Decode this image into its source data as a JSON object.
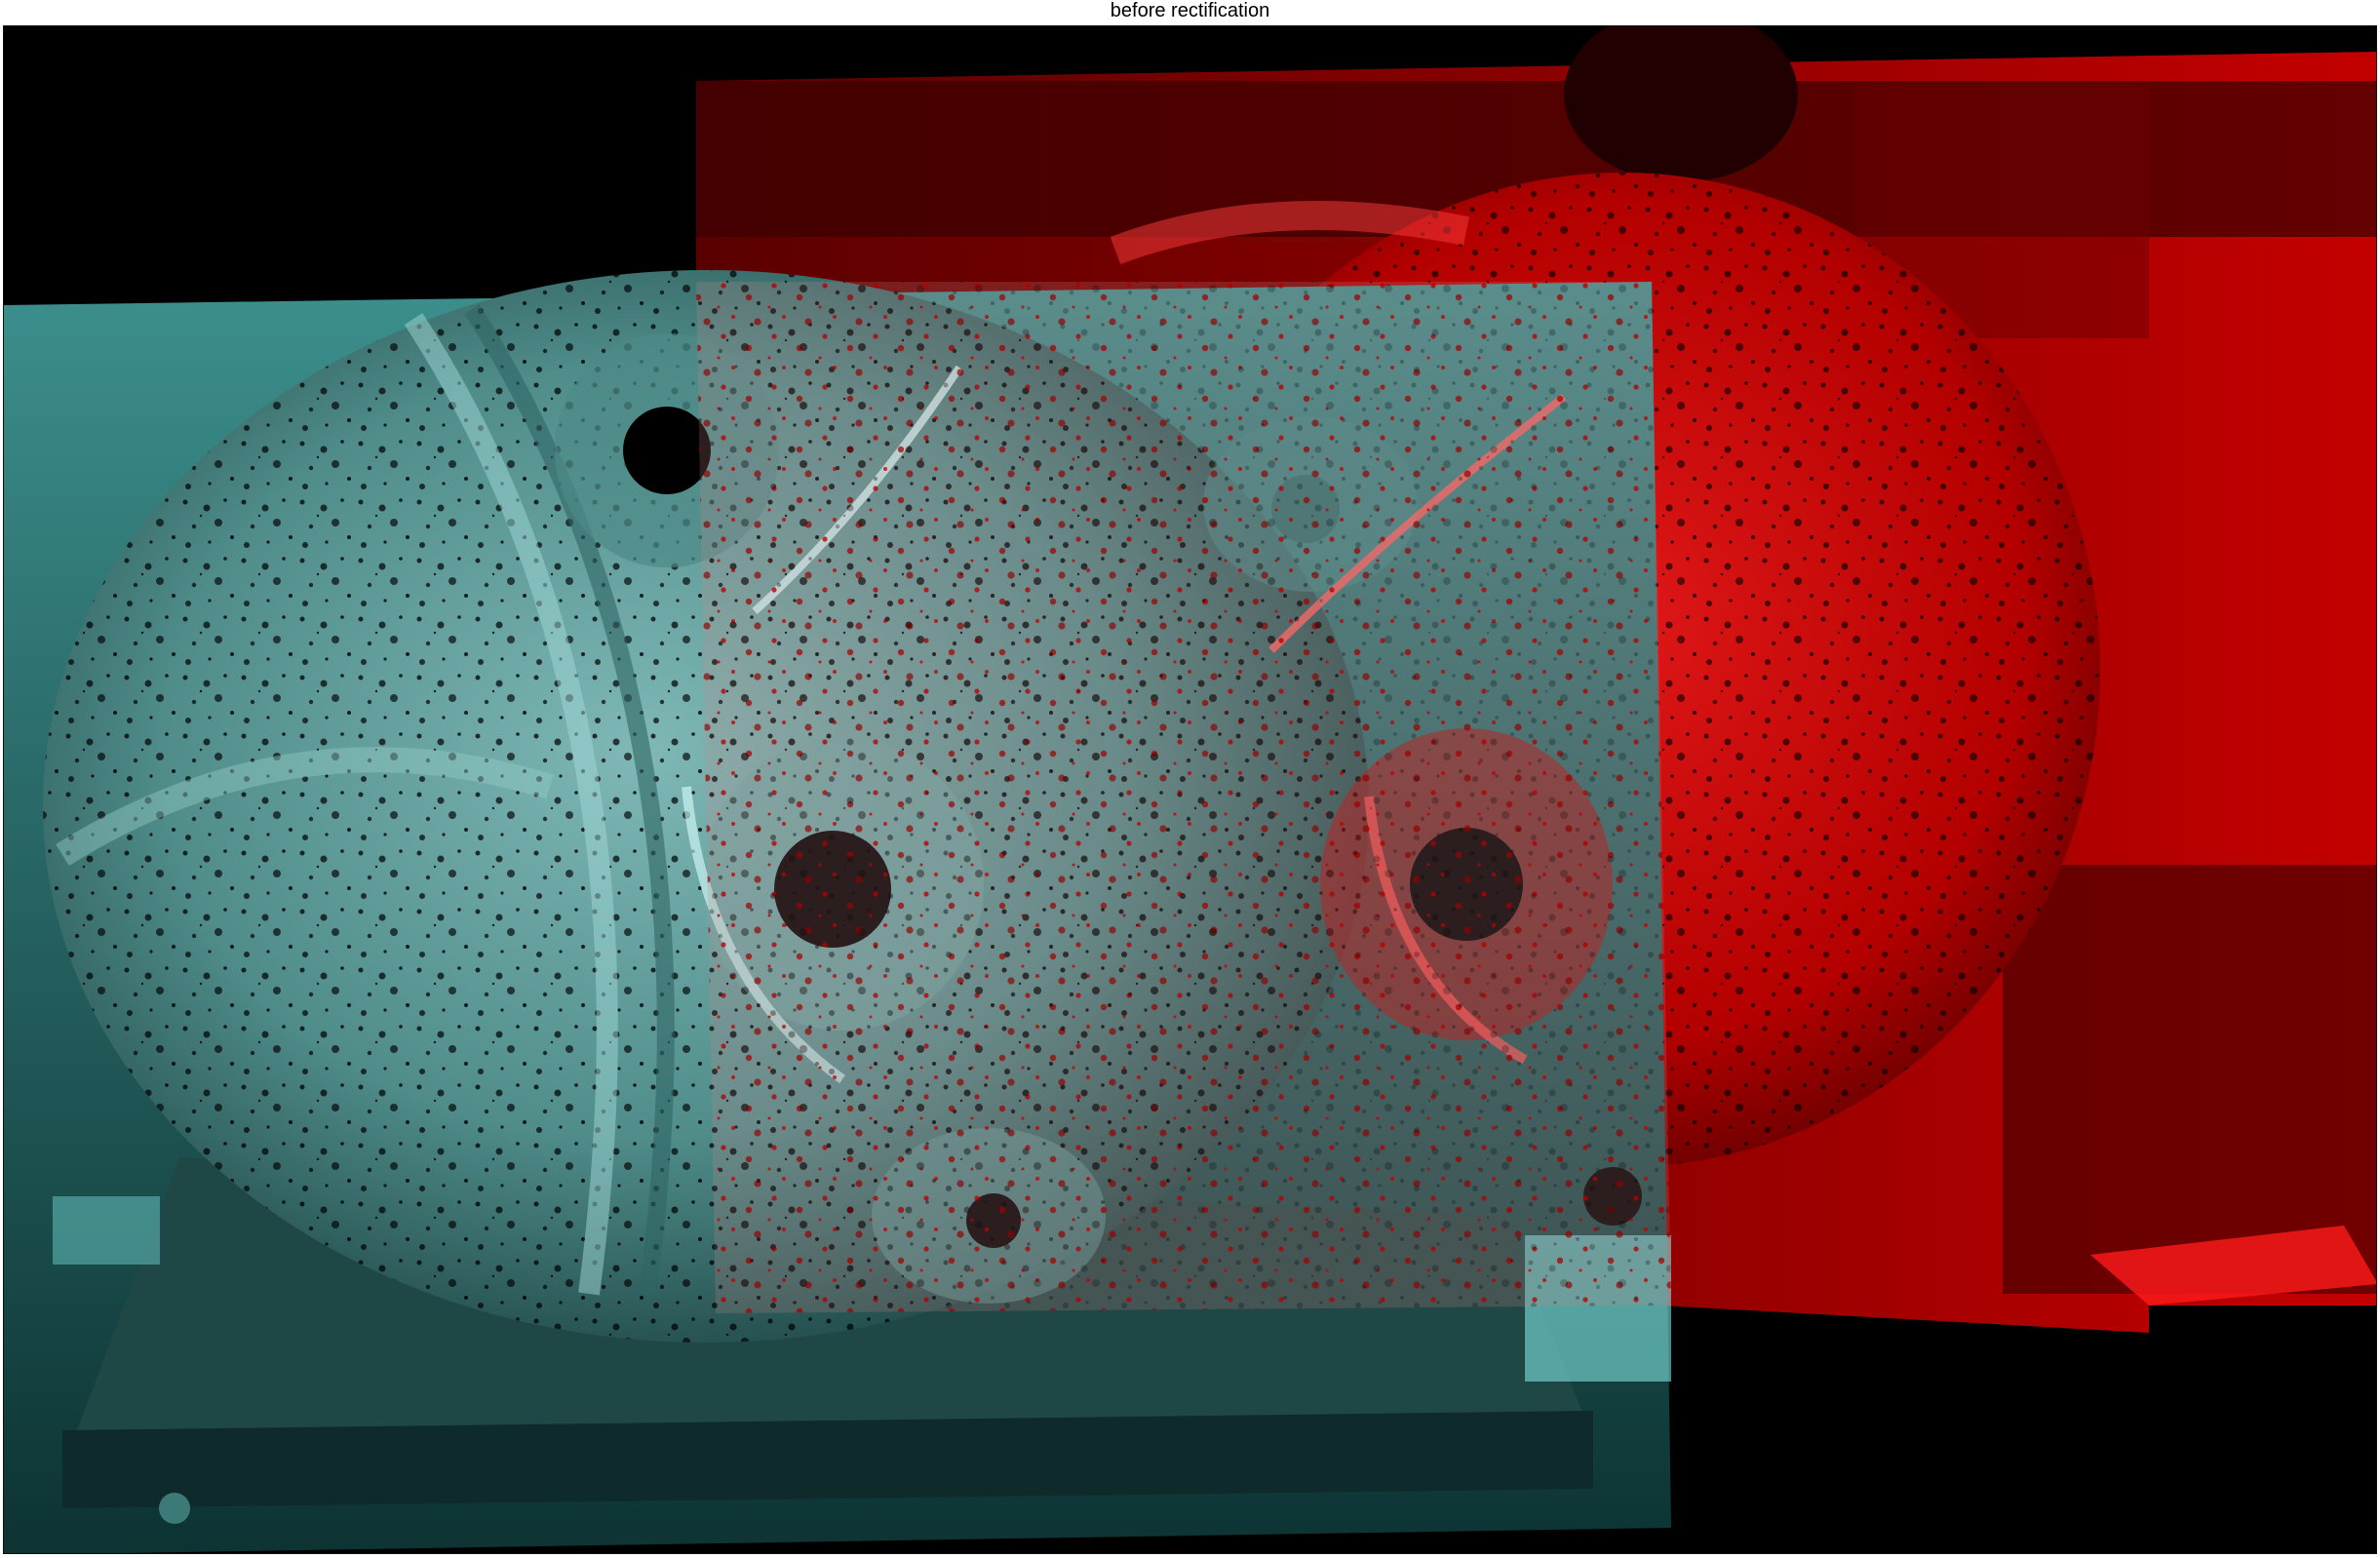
{
  "figure": {
    "title": "before rectification"
  },
  "image": {
    "description_tag": "stereo-anaglyph-overlay",
    "left_channel_color": "#00d0d0",
    "right_channel_color": "#e00000"
  }
}
